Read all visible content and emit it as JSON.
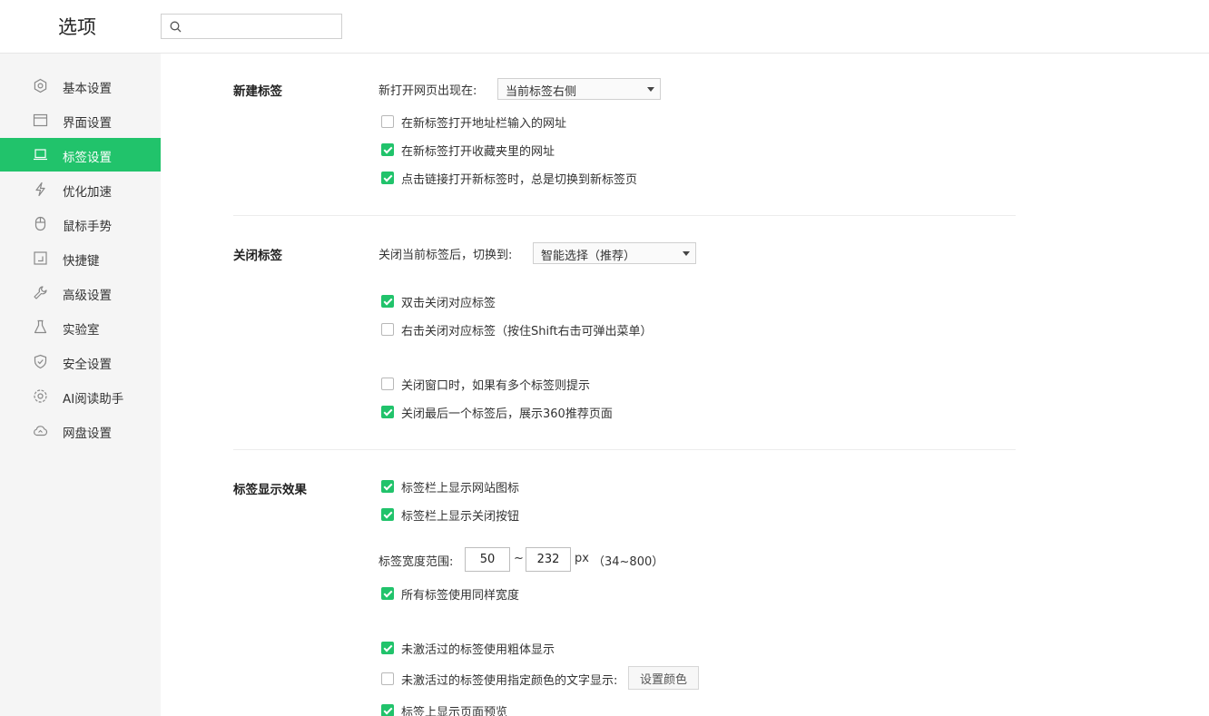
{
  "app": {
    "title": "选项"
  },
  "search": {
    "placeholder": ""
  },
  "sidebar": {
    "items": [
      {
        "label": "基本设置",
        "icon": "gear-icon"
      },
      {
        "label": "界面设置",
        "icon": "window-icon"
      },
      {
        "label": "标签设置",
        "icon": "tab-icon",
        "active": true
      },
      {
        "label": "优化加速",
        "icon": "lightning-icon"
      },
      {
        "label": "鼠标手势",
        "icon": "mouse-icon"
      },
      {
        "label": "快捷键",
        "icon": "shortcut-icon"
      },
      {
        "label": "高级设置",
        "icon": "wrench-icon"
      },
      {
        "label": "实验室",
        "icon": "flask-icon"
      },
      {
        "label": "安全设置",
        "icon": "shield-icon"
      },
      {
        "label": "AI阅读助手",
        "icon": "ai-icon"
      },
      {
        "label": "网盘设置",
        "icon": "cloud-icon"
      }
    ],
    "active_color": "#21c36b"
  },
  "new_tab": {
    "title": "新建标签",
    "open_position_label": "新打开网页出现在:",
    "open_position_value": "当前标签右侧",
    "options": [
      {
        "label": "在新标签打开地址栏输入的网址",
        "checked": false
      },
      {
        "label": "在新标签打开收藏夹里的网址",
        "checked": true
      },
      {
        "label": "点击链接打开新标签时，总是切换到新标签页",
        "checked": true
      }
    ]
  },
  "close_tab": {
    "title": "关闭标签",
    "switch_label": "关闭当前标签后，切换到:",
    "switch_value": "智能选择（推荐）",
    "options": [
      {
        "label": "双击关闭对应标签",
        "checked": true
      },
      {
        "label": "右击关闭对应标签（按住Shift右击可弹出菜单）",
        "checked": false
      },
      {
        "label": "关闭窗口时，如果有多个标签则提示",
        "checked": false
      },
      {
        "label": "关闭最后一个标签后，展示360推荐页面",
        "checked": true
      }
    ]
  },
  "display": {
    "title": "标签显示效果",
    "options": [
      {
        "label": "标签栏上显示网站图标",
        "checked": true
      },
      {
        "label": "标签栏上显示关闭按钮",
        "checked": true
      }
    ],
    "width_label": "标签宽度范围:",
    "width_min": "50",
    "width_sep": "~",
    "width_max": "232",
    "width_unit": "px",
    "width_hint": "（34~800）",
    "same_width": {
      "label": "所有标签使用同样宽度",
      "checked": true
    },
    "more_options": [
      {
        "label": "未激活过的标签使用粗体显示",
        "checked": true
      },
      {
        "label": "未激活过的标签使用指定颜色的文字显示:",
        "checked": false
      },
      {
        "label": "标签上显示页面预览",
        "checked": true
      }
    ],
    "set_color_button": "设置颜色"
  }
}
